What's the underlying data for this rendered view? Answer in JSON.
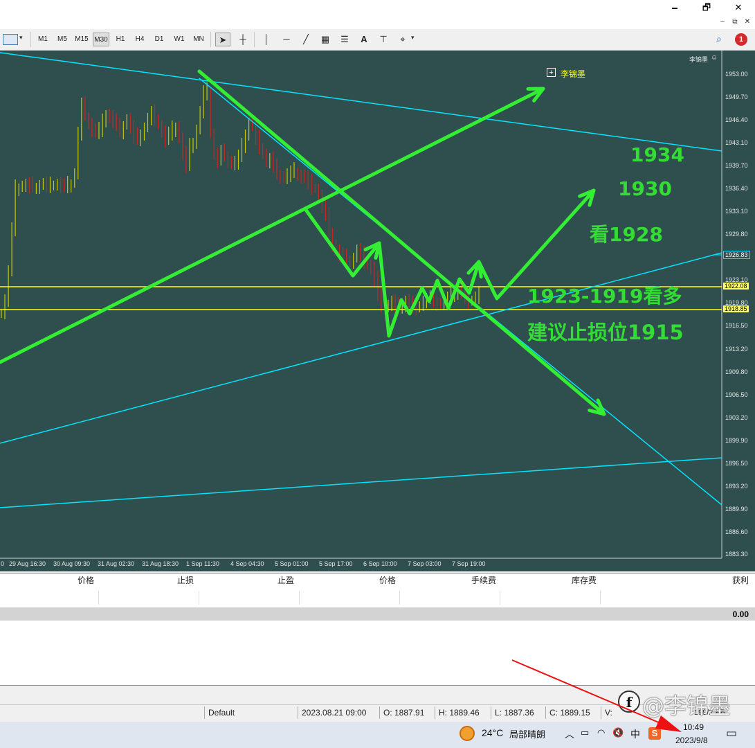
{
  "window": {
    "minimize": "🗕",
    "restore": "🗗",
    "close": "✕"
  },
  "mdi": {
    "minimize": "‒",
    "restore": "⧉",
    "close": "✕"
  },
  "toolbar": {
    "timeframes": [
      "M1",
      "M5",
      "M15",
      "M30",
      "H1",
      "H4",
      "D1",
      "W1",
      "MN"
    ],
    "active_timeframe": "M30",
    "tools": [
      "cursor-icon",
      "crosshair-icon",
      "vertical-line-icon",
      "horizontal-line-icon",
      "trendline-icon",
      "channel-icon",
      "fibonacci-icon",
      "text-icon",
      "text-label-icon",
      "shapes-icon"
    ],
    "text_tool": "A",
    "notification_count": "1"
  },
  "chart": {
    "signature": "李锦墨",
    "object_label": "李锦墨",
    "colors": {
      "background": "#2f4f4f",
      "arrow": "#33ee33",
      "trendline": "#00e5ff",
      "level": "#ffff00",
      "candle_bull": "#c8c800",
      "candle_bear": "#cc2222"
    },
    "price_ticks": [
      "1953.00",
      "1949.70",
      "1946.40",
      "1943.10",
      "1939.70",
      "1936.40",
      "1933.10",
      "1929.80",
      "1926.83",
      "1923.10",
      "1922.08",
      "1919.80",
      "1918.85",
      "1916.50",
      "1913.20",
      "1909.80",
      "1906.50",
      "1903.20",
      "1899.90",
      "1896.50",
      "1893.20",
      "1889.90",
      "1886.60",
      "1883.30"
    ],
    "current_price": "1926.83",
    "levels": [
      "1922.08",
      "1918.85"
    ],
    "date_ticks": [
      "0",
      "29 Aug 16:30",
      "30 Aug 09:30",
      "31 Aug 02:30",
      "31 Aug 18:30",
      "1 Sep 11:30",
      "4 Sep 04:30",
      "5 Sep 01:00",
      "5 Sep 17:00",
      "6 Sep 10:00",
      "7 Sep 03:00",
      "7 Sep 19:00"
    ],
    "annotations": {
      "target_1934": "1934",
      "target_1930": "1930",
      "target_1928": "看1928",
      "zone": "1923-1919看多",
      "stop": "建议止损位1915"
    }
  },
  "terminal": {
    "columns": [
      "价格",
      "止损",
      "止盈",
      "价格",
      "手续费",
      "库存费",
      "获利"
    ],
    "balance_profit": "0.00"
  },
  "statusbar": {
    "profile": "Default",
    "datetime": "2023.08.21 09:00",
    "open": "O: 1887.91",
    "high": "H: 1889.46",
    "low": "L: 1887.36",
    "close": "C: 1889.15",
    "volume": "V:",
    "connection": "199/2 KB"
  },
  "watermark": "@李锦墨",
  "taskbar": {
    "weather_temp": "24°C",
    "weather_desc": "局部晴朗",
    "ime": "中",
    "time": "10:49",
    "date": "2023/9/8"
  }
}
